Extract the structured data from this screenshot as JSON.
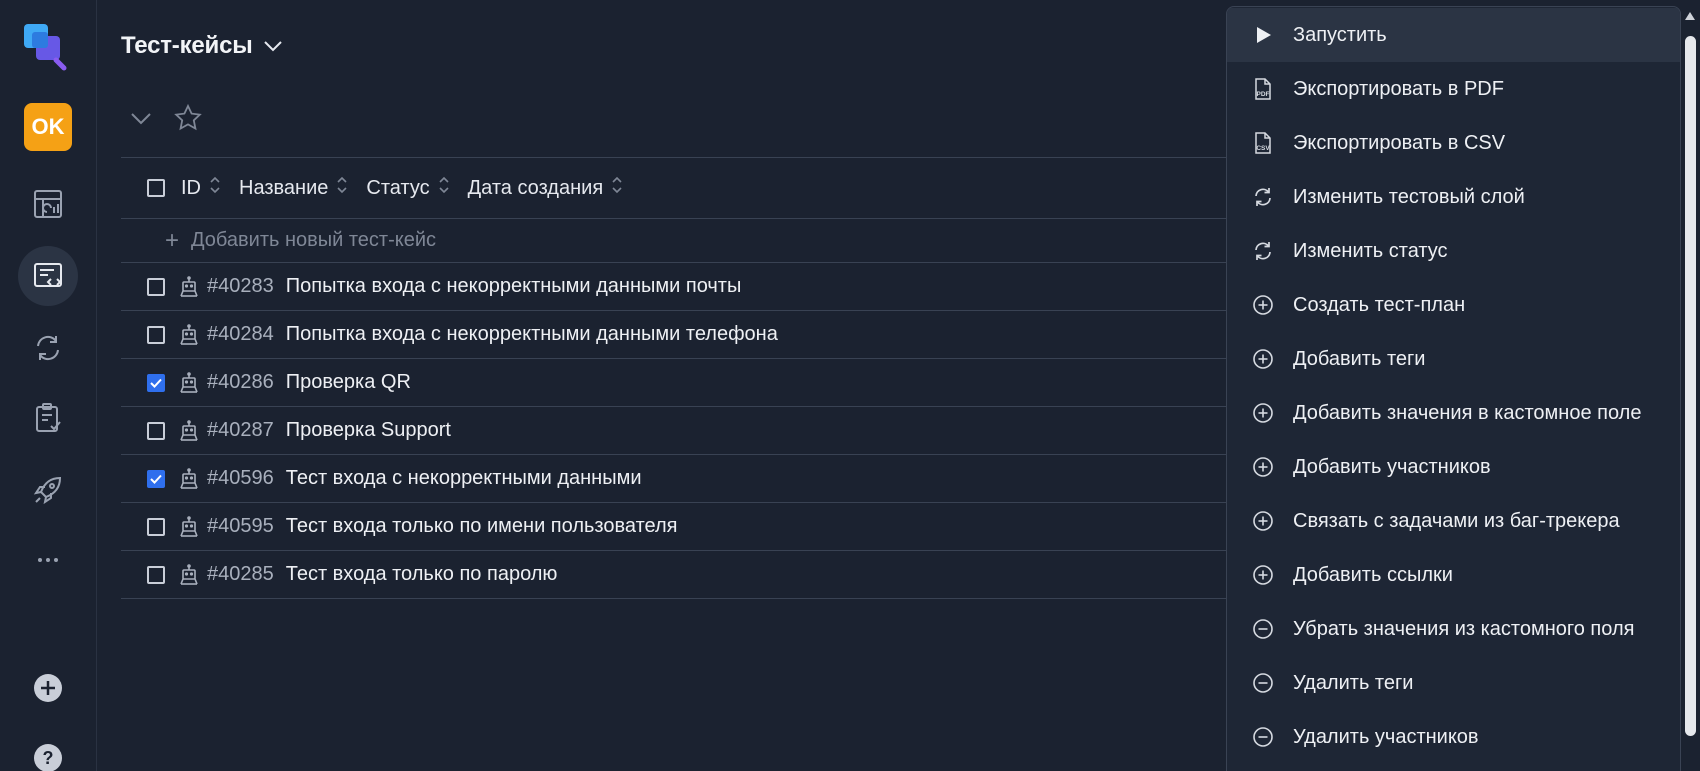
{
  "sidebar": {
    "logo": "app-logo",
    "badge": "OK",
    "items": [
      {
        "icon": "dashboard-icon"
      },
      {
        "icon": "test-cases-icon",
        "active": true
      },
      {
        "icon": "sync-icon"
      },
      {
        "icon": "clipboard-check-icon"
      },
      {
        "icon": "rocket-icon"
      },
      {
        "icon": "more-icon"
      }
    ],
    "bottom": [
      {
        "icon": "add-circle-icon"
      },
      {
        "icon": "help-icon"
      }
    ]
  },
  "header": {
    "title": "Тест-кейсы"
  },
  "table": {
    "columns": [
      "ID",
      "Название",
      "Статус",
      "Дата создания"
    ],
    "add_label": "Добавить новый тест-кейс",
    "rows": [
      {
        "id": "#40283",
        "name": "Попытка входа с некорректными данными почты",
        "checked": false
      },
      {
        "id": "#40284",
        "name": "Попытка входа с некорректными данными телефона",
        "checked": false
      },
      {
        "id": "#40286",
        "name": "Проверка QR",
        "checked": true
      },
      {
        "id": "#40287",
        "name": "Проверка Support",
        "checked": false
      },
      {
        "id": "#40596",
        "name": "Тест входа с некорректными данными",
        "checked": true
      },
      {
        "id": "#40595",
        "name": "Тест входа только по имени пользователя",
        "checked": false
      },
      {
        "id": "#40285",
        "name": "Тест входа только по паролю",
        "checked": false
      }
    ]
  },
  "menu": {
    "items": [
      {
        "label": "Запустить",
        "icon": "play-icon"
      },
      {
        "label": "Экспортировать в PDF",
        "icon": "pdf-file-icon"
      },
      {
        "label": "Экспортировать в CSV",
        "icon": "csv-file-icon"
      },
      {
        "label": "Изменить тестовый слой",
        "icon": "refresh-icon"
      },
      {
        "label": "Изменить статус",
        "icon": "refresh-icon"
      },
      {
        "label": "Создать тест-план",
        "icon": "plus-circle-icon"
      },
      {
        "label": "Добавить теги",
        "icon": "plus-circle-icon"
      },
      {
        "label": "Добавить значения в кастомное поле",
        "icon": "plus-circle-icon"
      },
      {
        "label": "Добавить участников",
        "icon": "plus-circle-icon"
      },
      {
        "label": "Связать с задачами из баг-трекера",
        "icon": "plus-circle-icon"
      },
      {
        "label": "Добавить ссылки",
        "icon": "plus-circle-icon"
      },
      {
        "label": "Убрать значения из кастомного поля",
        "icon": "minus-circle-icon"
      },
      {
        "label": "Удалить теги",
        "icon": "minus-circle-icon"
      },
      {
        "label": "Удалить участников",
        "icon": "minus-circle-icon"
      }
    ]
  },
  "colors": {
    "background": "#1b2230",
    "menu_bg": "#1e2635",
    "accent_checkbox": "#2f6fed",
    "badge": "#f5a115"
  }
}
